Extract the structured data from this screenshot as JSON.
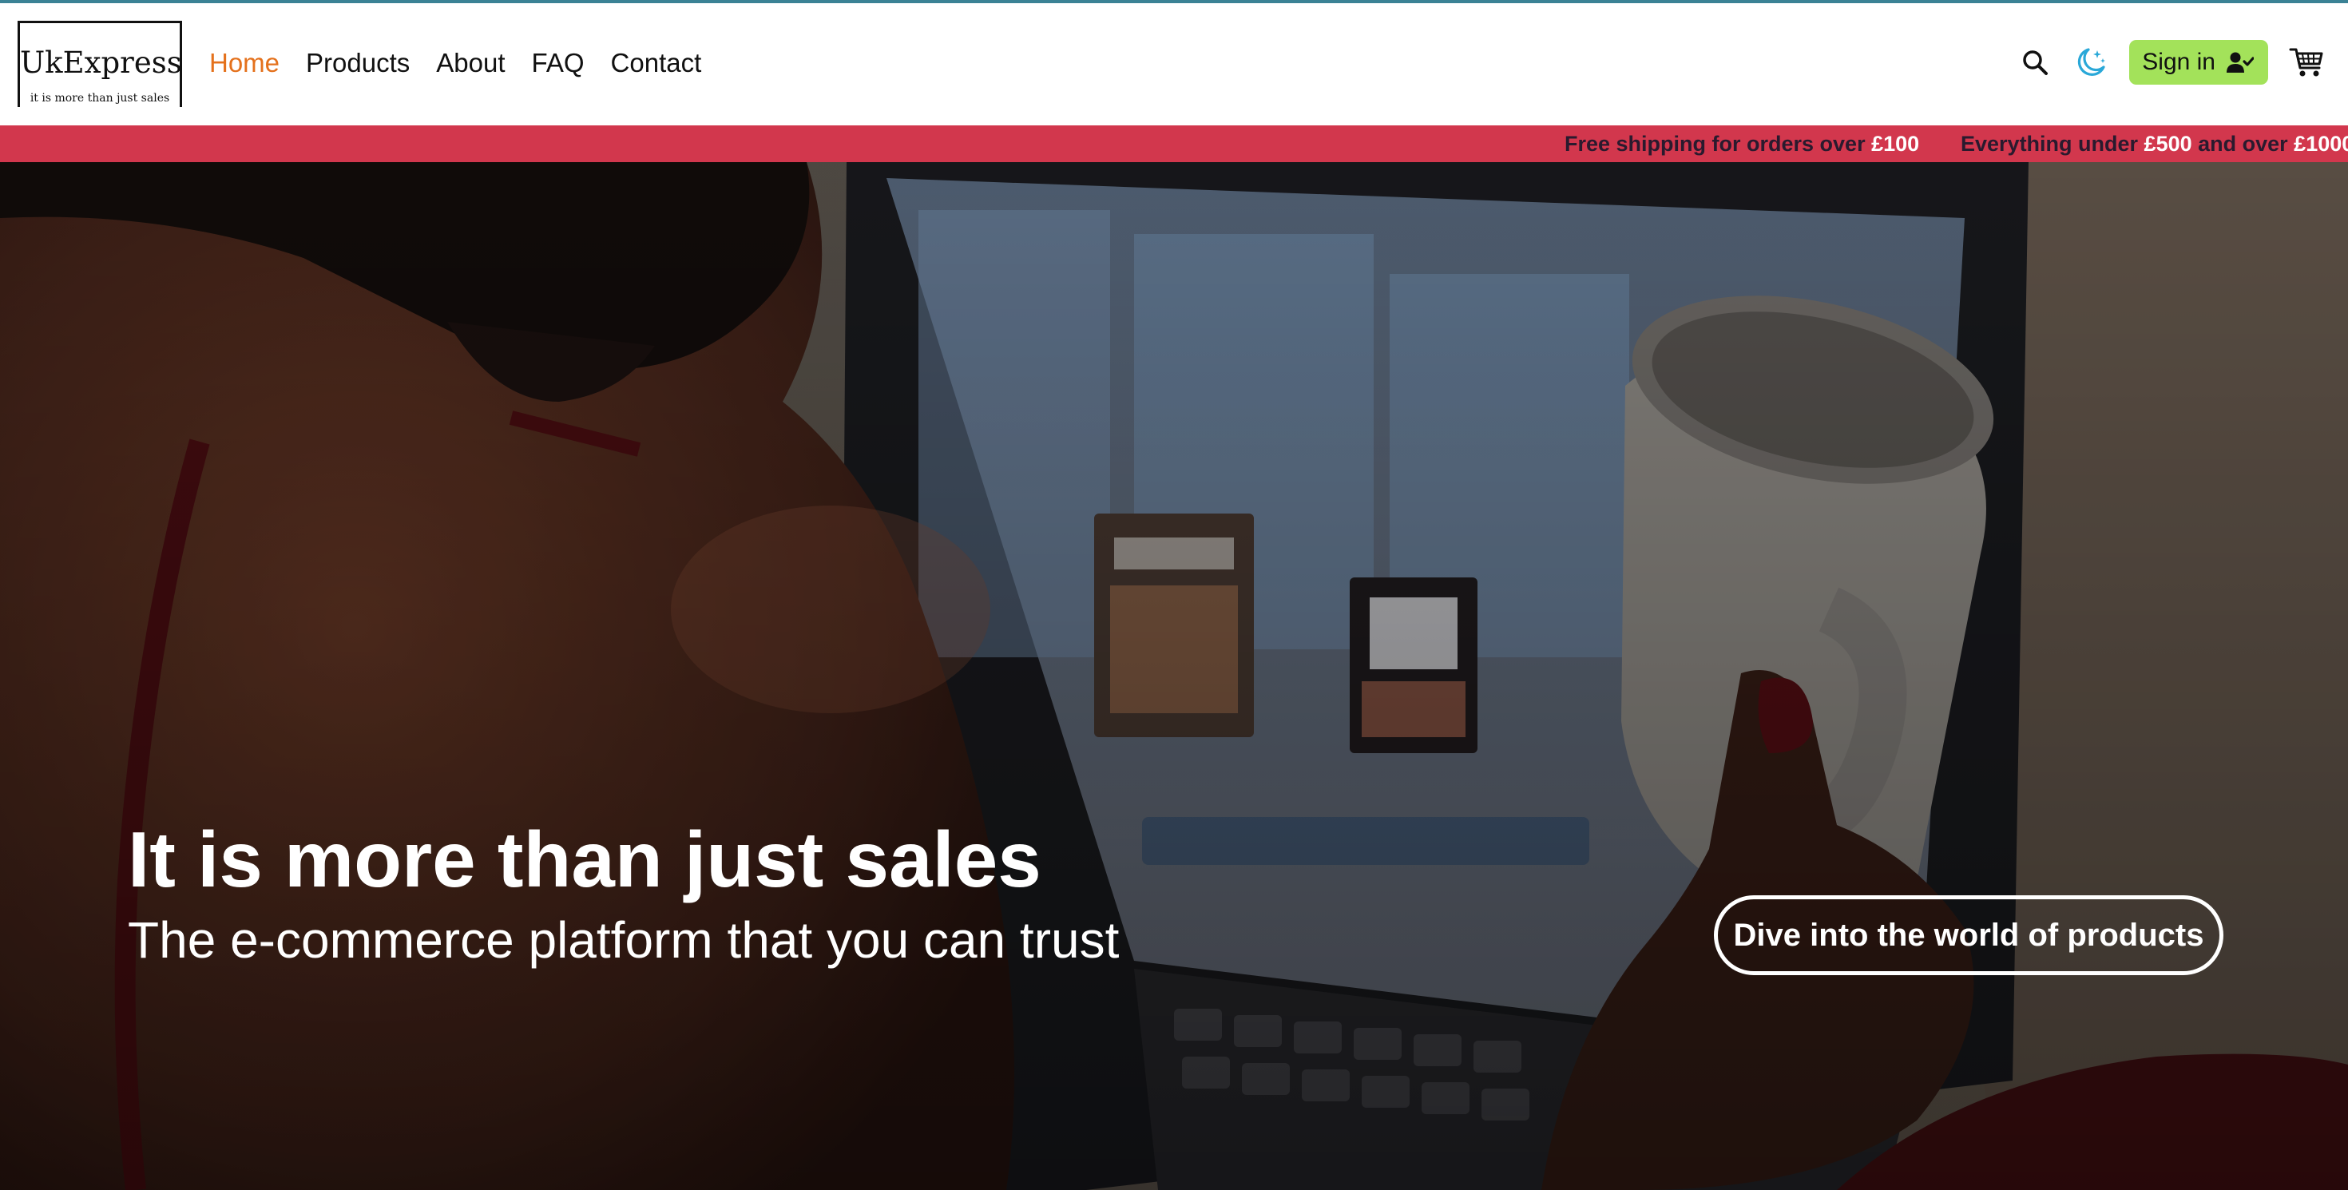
{
  "logo": {
    "name": "UkExpress",
    "tagline": "it is more than just sales"
  },
  "nav": {
    "items": [
      {
        "label": "Home",
        "active": true
      },
      {
        "label": "Products"
      },
      {
        "label": "About"
      },
      {
        "label": "FAQ"
      },
      {
        "label": "Contact"
      }
    ]
  },
  "header": {
    "search_icon": "search-icon",
    "theme_icon": "moon-stars-icon",
    "signin_label": "Sign in",
    "signin_icon": "user-check-icon",
    "cart_icon": "cart-icon"
  },
  "promo": {
    "shipping_text": "Free shipping for orders over ",
    "shipping_amount": "£100",
    "everything_prefix": "Everything under ",
    "everything_amount1": "£500",
    "everything_middle": " and over ",
    "everything_amount2": "£1000"
  },
  "hero": {
    "title": "It is more than just sales",
    "subtitle": "The e-commerce platform that you can trust",
    "cta_label": "Dive into the world of products"
  },
  "colors": {
    "accent": "#e4711c",
    "promo_bg": "#d2374d",
    "signin_bg": "#a3e25a",
    "topline": "#3b8295"
  }
}
